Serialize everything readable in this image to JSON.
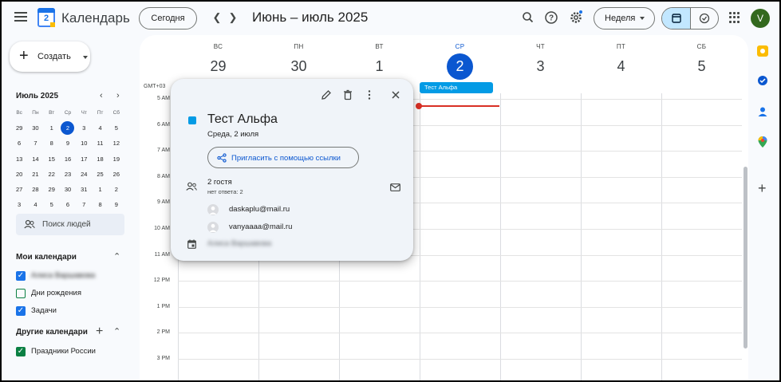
{
  "header": {
    "app_title": "Календарь",
    "logo_day": "2",
    "today_label": "Сегодня",
    "prev_icon": "chevron-left",
    "next_icon": "chevron-right",
    "period_title": "Июнь – июль 2025",
    "view_label": "Неделя",
    "avatar_letter": "V"
  },
  "sidebar": {
    "create_label": "Создать",
    "mini_calendar": {
      "title": "Июль 2025",
      "weekdays": [
        "Вс",
        "Пн",
        "Вт",
        "Ср",
        "Чт",
        "Пт",
        "Сб"
      ],
      "weeks": [
        [
          "29",
          "30",
          "1",
          "2",
          "3",
          "4",
          "5"
        ],
        [
          "6",
          "7",
          "8",
          "9",
          "10",
          "11",
          "12"
        ],
        [
          "13",
          "14",
          "15",
          "16",
          "17",
          "18",
          "19"
        ],
        [
          "20",
          "21",
          "22",
          "23",
          "24",
          "25",
          "26"
        ],
        [
          "27",
          "28",
          "29",
          "30",
          "31",
          "1",
          "2"
        ],
        [
          "3",
          "4",
          "5",
          "6",
          "7",
          "8",
          "9"
        ]
      ],
      "today": "2"
    },
    "search_people": "Поиск людей",
    "my_calendars_title": "Мои календари",
    "my_calendars": [
      {
        "label": "Алиса Варшавова",
        "checked": true,
        "color": "#1a73e8",
        "blurred": true
      },
      {
        "label": "Дни рождения",
        "checked": false,
        "color": "#0b8043",
        "blurred": false
      },
      {
        "label": "Задачи",
        "checked": true,
        "color": "#1a73e8",
        "blurred": false
      }
    ],
    "other_calendars_title": "Другие календари",
    "other_calendars": [
      {
        "label": "Праздники России",
        "checked": true,
        "color": "#0b8043"
      }
    ]
  },
  "week": {
    "days": [
      {
        "name": "ВС",
        "num": "29"
      },
      {
        "name": "ПН",
        "num": "30"
      },
      {
        "name": "ВТ",
        "num": "1"
      },
      {
        "name": "СР",
        "num": "2"
      },
      {
        "name": "ЧТ",
        "num": "3"
      },
      {
        "name": "ПТ",
        "num": "4"
      },
      {
        "name": "СБ",
        "num": "5"
      }
    ],
    "current_day_index": 3,
    "timezone": "GMT+03",
    "hours": [
      "5 AM",
      "6 AM",
      "7 AM",
      "8 AM",
      "9 AM",
      "10 AM",
      "11 AM",
      "12 PM",
      "1 PM",
      "2 PM",
      "3 PM"
    ],
    "allday_event": "Тест Альфа"
  },
  "popup": {
    "title": "Тест Альфа",
    "date": "Среда, 2 июля",
    "invite_label": "Пригласить с помощью ссылки",
    "guests_title": "2 гостя",
    "guests_sub": "нет ответа: 2",
    "guests": [
      "daskaplu@mail.ru",
      "vanyaaaa@mail.ru"
    ],
    "owner": "Алиса Варшавова"
  },
  "colors": {
    "accent": "#0b57d0",
    "event": "#039be5",
    "now_line": "#d93025"
  }
}
